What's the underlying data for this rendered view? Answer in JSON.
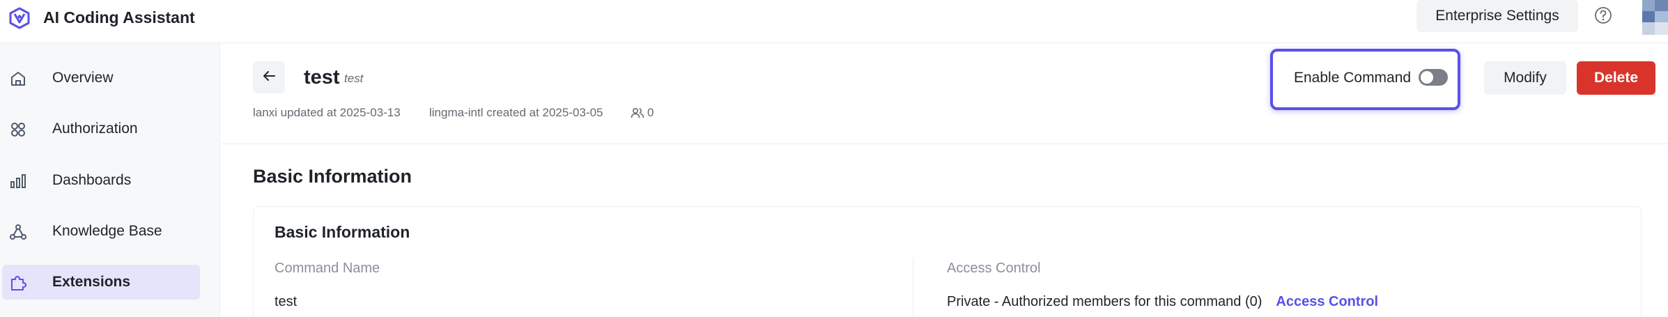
{
  "header": {
    "app_title": "AI Coding Assistant",
    "enterprise_settings_label": "Enterprise Settings"
  },
  "sidebar": {
    "items": [
      {
        "label": "Overview",
        "icon": "home-icon",
        "active": false
      },
      {
        "label": "Authorization",
        "icon": "grid-icon",
        "active": false
      },
      {
        "label": "Dashboards",
        "icon": "bar-chart-icon",
        "active": false
      },
      {
        "label": "Knowledge Base",
        "icon": "network-icon",
        "active": false
      },
      {
        "label": "Extensions",
        "icon": "puzzle-icon",
        "active": true
      }
    ]
  },
  "page": {
    "title": "test",
    "subtitle": "test",
    "updated_info": "lanxi updated at 2025-03-13",
    "created_info": "lingma-intl created at 2025-03-05",
    "member_count": "0",
    "enable_command_label": "Enable Command",
    "enable_command_on": false,
    "modify_label": "Modify",
    "delete_label": "Delete"
  },
  "basic_info": {
    "section_title": "Basic Information",
    "card_title": "Basic Information",
    "command_name_label": "Command Name",
    "command_name_value": "test",
    "access_control_label": "Access Control",
    "access_control_value": "Private - Authorized members for this command (0)",
    "access_control_link": "Access Control"
  },
  "colors": {
    "accent": "#5b4fe9",
    "danger": "#d8342c",
    "active_nav_bg": "#e5e4fb"
  }
}
